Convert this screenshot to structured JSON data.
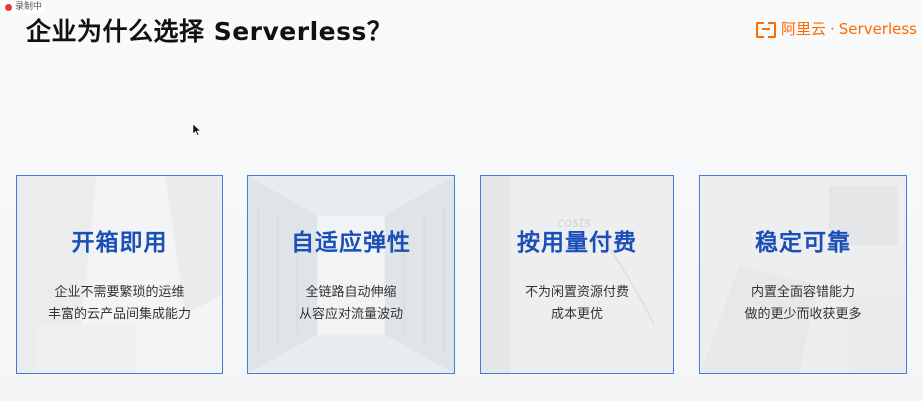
{
  "recording": {
    "label": "录制中"
  },
  "title": "企业为什么选择 Serverless？",
  "logo": {
    "brand": "阿里云",
    "separator": "·",
    "product": "Serverless"
  },
  "cards": [
    {
      "heading": "开箱即用",
      "lines": [
        "企业不需要繁琐的运维",
        "丰富的云产品间集成能力"
      ]
    },
    {
      "heading": "自适应弹性",
      "lines": [
        "全链路自动伸缩",
        "从容应对流量波动"
      ]
    },
    {
      "heading": "按用量付费",
      "lines": [
        "不为闲置资源付费",
        "成本更优"
      ],
      "bg_text": "costs"
    },
    {
      "heading": "稳定可靠",
      "lines": [
        "内置全面容错能力",
        "做的更少而收获更多"
      ]
    }
  ],
  "colors": {
    "accent": "#1a4fb8",
    "border": "#3f7fd6",
    "brand": "#ff6a00",
    "recording": "#e53935"
  }
}
